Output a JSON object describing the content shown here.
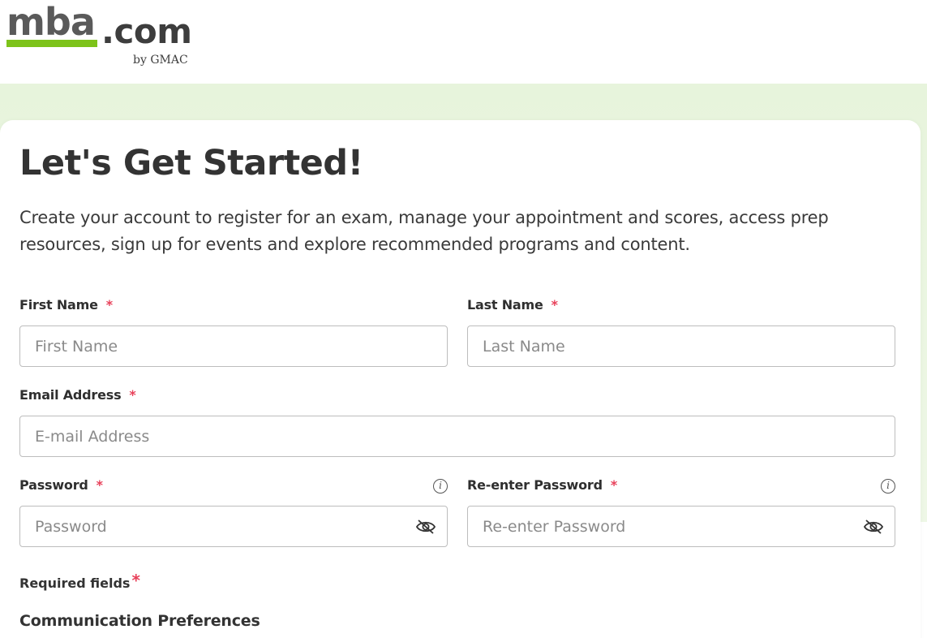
{
  "brand": {
    "logo_main": "mba",
    "logo_tld": ".com",
    "logo_sub": "by GMAC",
    "accent_color": "#7dc31a",
    "band_color": "#e7f4dc"
  },
  "page": {
    "title": "Let's Get Started!",
    "intro": "Create your account to register for an exam, manage your appointment and scores, access prep resources, sign up for events and explore recommended programs and content."
  },
  "form": {
    "required_marker": "*",
    "first_name": {
      "label": "First Name",
      "placeholder": "First Name",
      "value": ""
    },
    "last_name": {
      "label": "Last Name",
      "placeholder": "Last Name",
      "value": ""
    },
    "email": {
      "label": "Email Address",
      "placeholder": "E-mail Address",
      "value": ""
    },
    "password": {
      "label": "Password",
      "placeholder": "Password",
      "value": "",
      "info_icon": "info-icon",
      "toggle_icon": "eye-slash-icon"
    },
    "confirm_password": {
      "label": "Re-enter Password",
      "placeholder": "Re-enter Password",
      "value": "",
      "info_icon": "info-icon",
      "toggle_icon": "eye-slash-icon"
    },
    "required_note": "Required fields",
    "section_heading": "Communication Preferences"
  }
}
